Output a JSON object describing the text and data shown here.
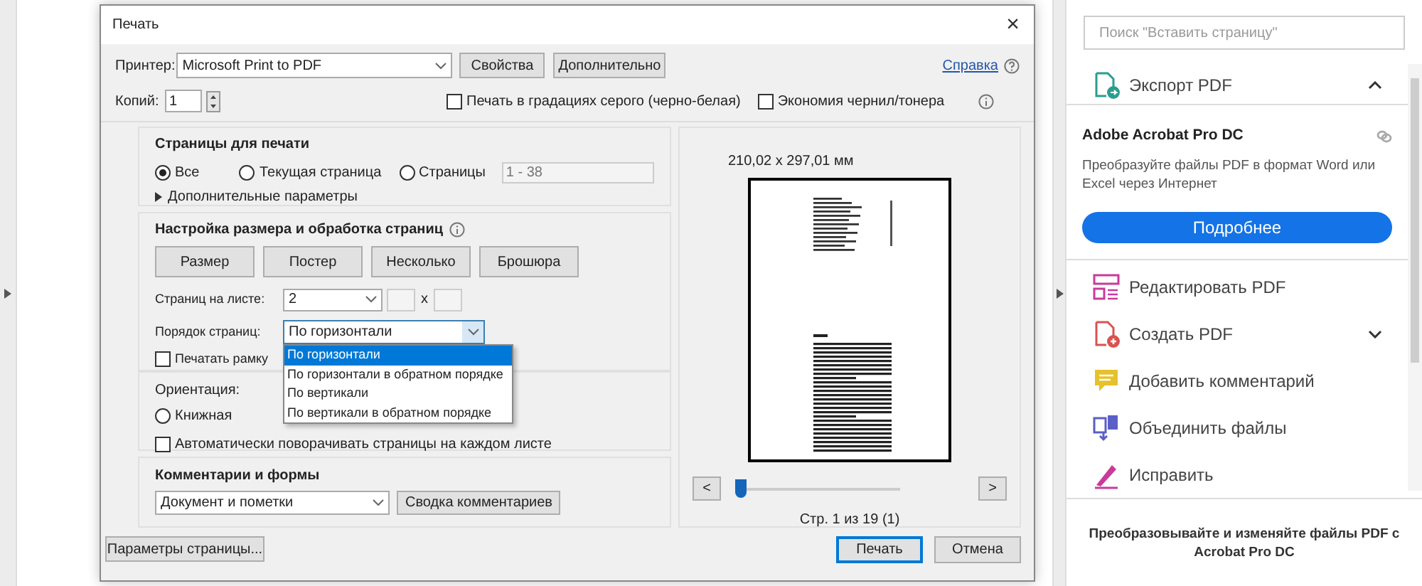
{
  "window": {
    "title": "Печать",
    "close": "×"
  },
  "printer": {
    "label": "Принтер:",
    "value": "Microsoft Print to PDF"
  },
  "top_buttons": [
    "Свойства",
    "Дополнительно"
  ],
  "help_link": "Справка",
  "copies": {
    "label": "Копий:",
    "value": "1"
  },
  "options": [
    {
      "label": "Печать в градациях серого (черно-белая)",
      "checked": false
    },
    {
      "label": "Экономия чернил/тонера",
      "checked": false
    }
  ],
  "pages_section": {
    "title": "Страницы для печати",
    "choices": [
      {
        "label": "Все",
        "selected": true
      },
      {
        "label": "Текущая страница",
        "selected": false
      },
      {
        "label": "Страницы",
        "selected": false
      }
    ],
    "range": {
      "value": "1 - 38",
      "disabled": true
    },
    "more": "Дополнительные параметры"
  },
  "sizing": {
    "title": "Настройка размера и обработка страниц",
    "modes": [
      "Размер",
      "Постер",
      "Несколько",
      "Брошюра"
    ],
    "per_sheet": {
      "label": "Страниц на листе:",
      "value": "2"
    },
    "times": "x",
    "order": {
      "label": "Порядок страниц:",
      "value": "По горизонтали",
      "expanded": true,
      "options": [
        {
          "label": "По горизонтали",
          "selected": true
        },
        {
          "label": "По горизонтали в обратном порядке",
          "selected": false
        },
        {
          "label": "По вертикали",
          "selected": false
        },
        {
          "label": "По вертикали в обратном порядке",
          "selected": false
        }
      ]
    },
    "border": {
      "label": "Печатать рамку",
      "checked": false
    }
  },
  "orientation": {
    "title": "Ориентация:",
    "choices": [
      {
        "label": "Книжная",
        "selected": false
      }
    ],
    "auto_rotate": {
      "label": "Автоматически поворачивать страницы на каждом листе",
      "checked": false
    }
  },
  "comments": {
    "title": "Комментарии и формы",
    "value": "Документ и пометки",
    "button": "Сводка комментариев"
  },
  "page_setup_button": "Параметры страницы...",
  "preview": {
    "size": "210,02 x 297,01 мм",
    "prev": "<",
    "next": ">",
    "level": 0,
    "page_info": "Стр. 1 из 19 (1)"
  },
  "actions": [
    {
      "label": "Печать",
      "default": true
    },
    {
      "label": "Отмена",
      "default": false
    }
  ],
  "sidebar": {
    "search": {
      "placeholder": "Поиск \"Вставить страницу\""
    },
    "export": {
      "label": "Экспорт PDF",
      "expanded": true
    },
    "promo": {
      "title": "Adobe Acrobat Pro DC",
      "text": "Преобразуйте файлы PDF в формат Word или Excel через Интернет",
      "button": "Подробнее"
    },
    "tools": [
      {
        "kind": "edit",
        "label": "Редактировать PDF",
        "has_menu": false
      },
      {
        "kind": "create",
        "label": "Создать PDF",
        "has_menu": true
      },
      {
        "kind": "comment",
        "label": "Добавить комментарий",
        "has_menu": false
      },
      {
        "kind": "combine",
        "label": "Объединить файлы",
        "has_menu": false
      },
      {
        "kind": "fix",
        "label": "Исправить",
        "has_menu": false
      }
    ],
    "footer": "Преобразовывайте и изменяйте файлы PDF с Acrobat Pro DC"
  }
}
